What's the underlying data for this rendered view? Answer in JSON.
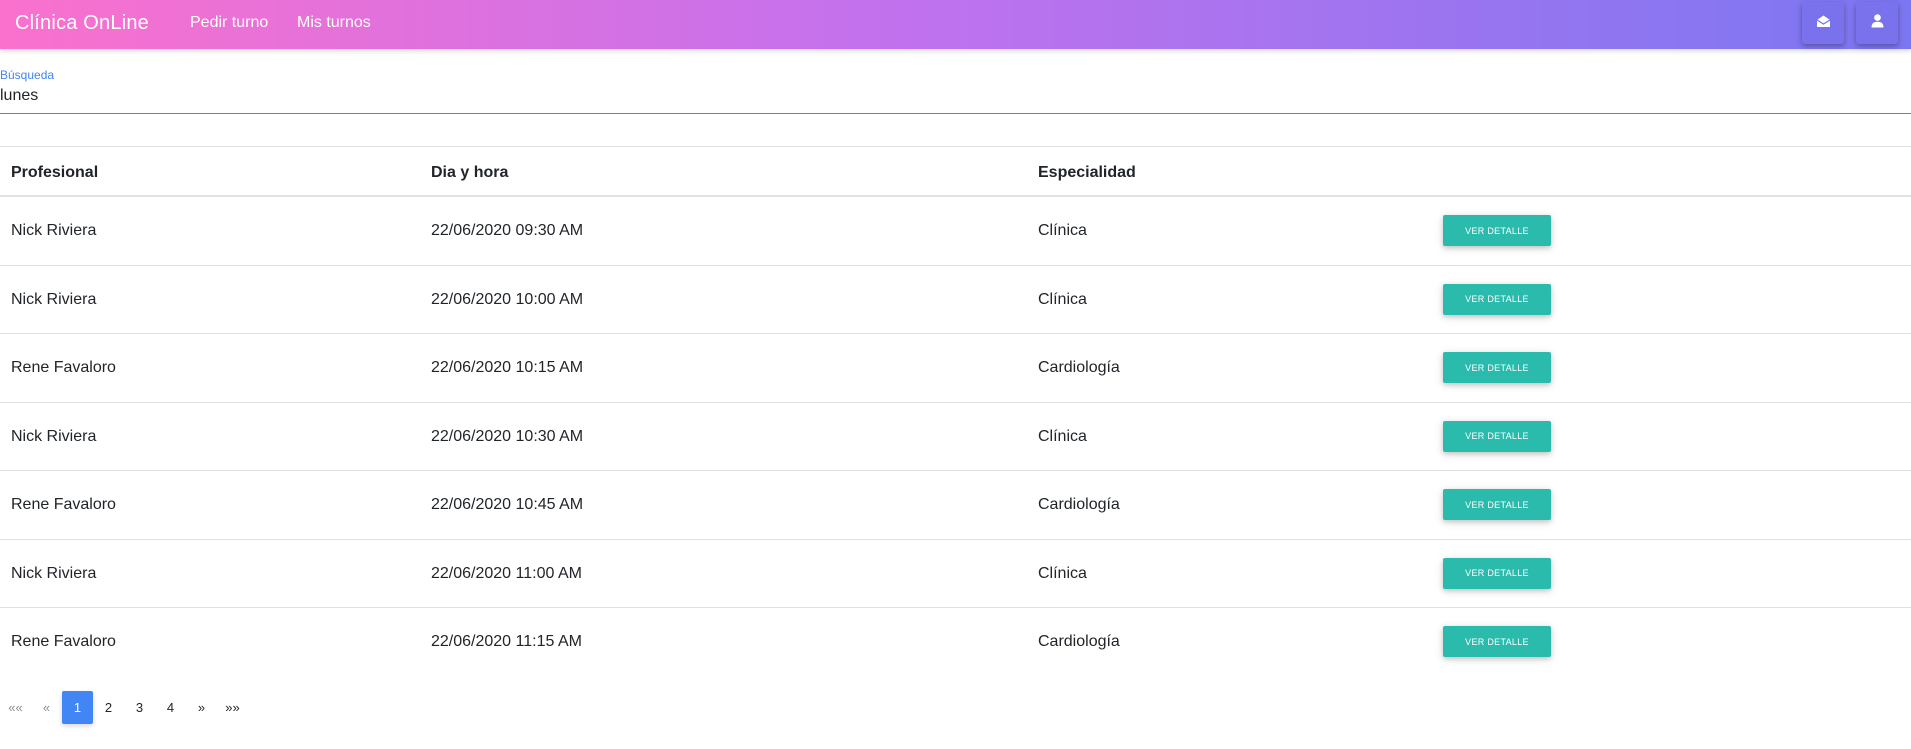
{
  "navbar": {
    "brand": "Clínica OnLine",
    "links": [
      "Pedir turno",
      "Mis turnos"
    ],
    "icons": [
      "envelope-open-icon",
      "user-icon"
    ],
    "gradient": [
      "#fa71cd",
      "#c471ed",
      "#7b77f2"
    ]
  },
  "search": {
    "label": "Búsqueda",
    "value": "lunes"
  },
  "table": {
    "headers": [
      "Profesional",
      "Dia y hora",
      "Especialidad"
    ],
    "rows": [
      {
        "profesional": "Nick Riviera",
        "fecha": "22/06/2020 09:30 AM",
        "especialidad": "Clínica",
        "action": "VER DETALLE"
      },
      {
        "profesional": "Nick Riviera",
        "fecha": "22/06/2020 10:00 AM",
        "especialidad": "Clínica",
        "action": "VER DETALLE"
      },
      {
        "profesional": "Rene Favaloro",
        "fecha": "22/06/2020 10:15 AM",
        "especialidad": "Cardiología",
        "action": "VER DETALLE"
      },
      {
        "profesional": "Nick Riviera",
        "fecha": "22/06/2020 10:30 AM",
        "especialidad": "Clínica",
        "action": "VER DETALLE"
      },
      {
        "profesional": "Rene Favaloro",
        "fecha": "22/06/2020 10:45 AM",
        "especialidad": "Cardiología",
        "action": "VER DETALLE"
      },
      {
        "profesional": "Nick Riviera",
        "fecha": "22/06/2020 11:00 AM",
        "especialidad": "Clínica",
        "action": "VER DETALLE"
      },
      {
        "profesional": "Rene Favaloro",
        "fecha": "22/06/2020 11:15 AM",
        "especialidad": "Cardiología",
        "action": "VER DETALLE"
      }
    ],
    "button_color": "#2bbbad"
  },
  "pagination": {
    "first": "««",
    "prev": "«",
    "pages": [
      "1",
      "2",
      "3",
      "4"
    ],
    "active": "1",
    "next": "»",
    "last": "»»",
    "active_color": "#4285f4"
  }
}
